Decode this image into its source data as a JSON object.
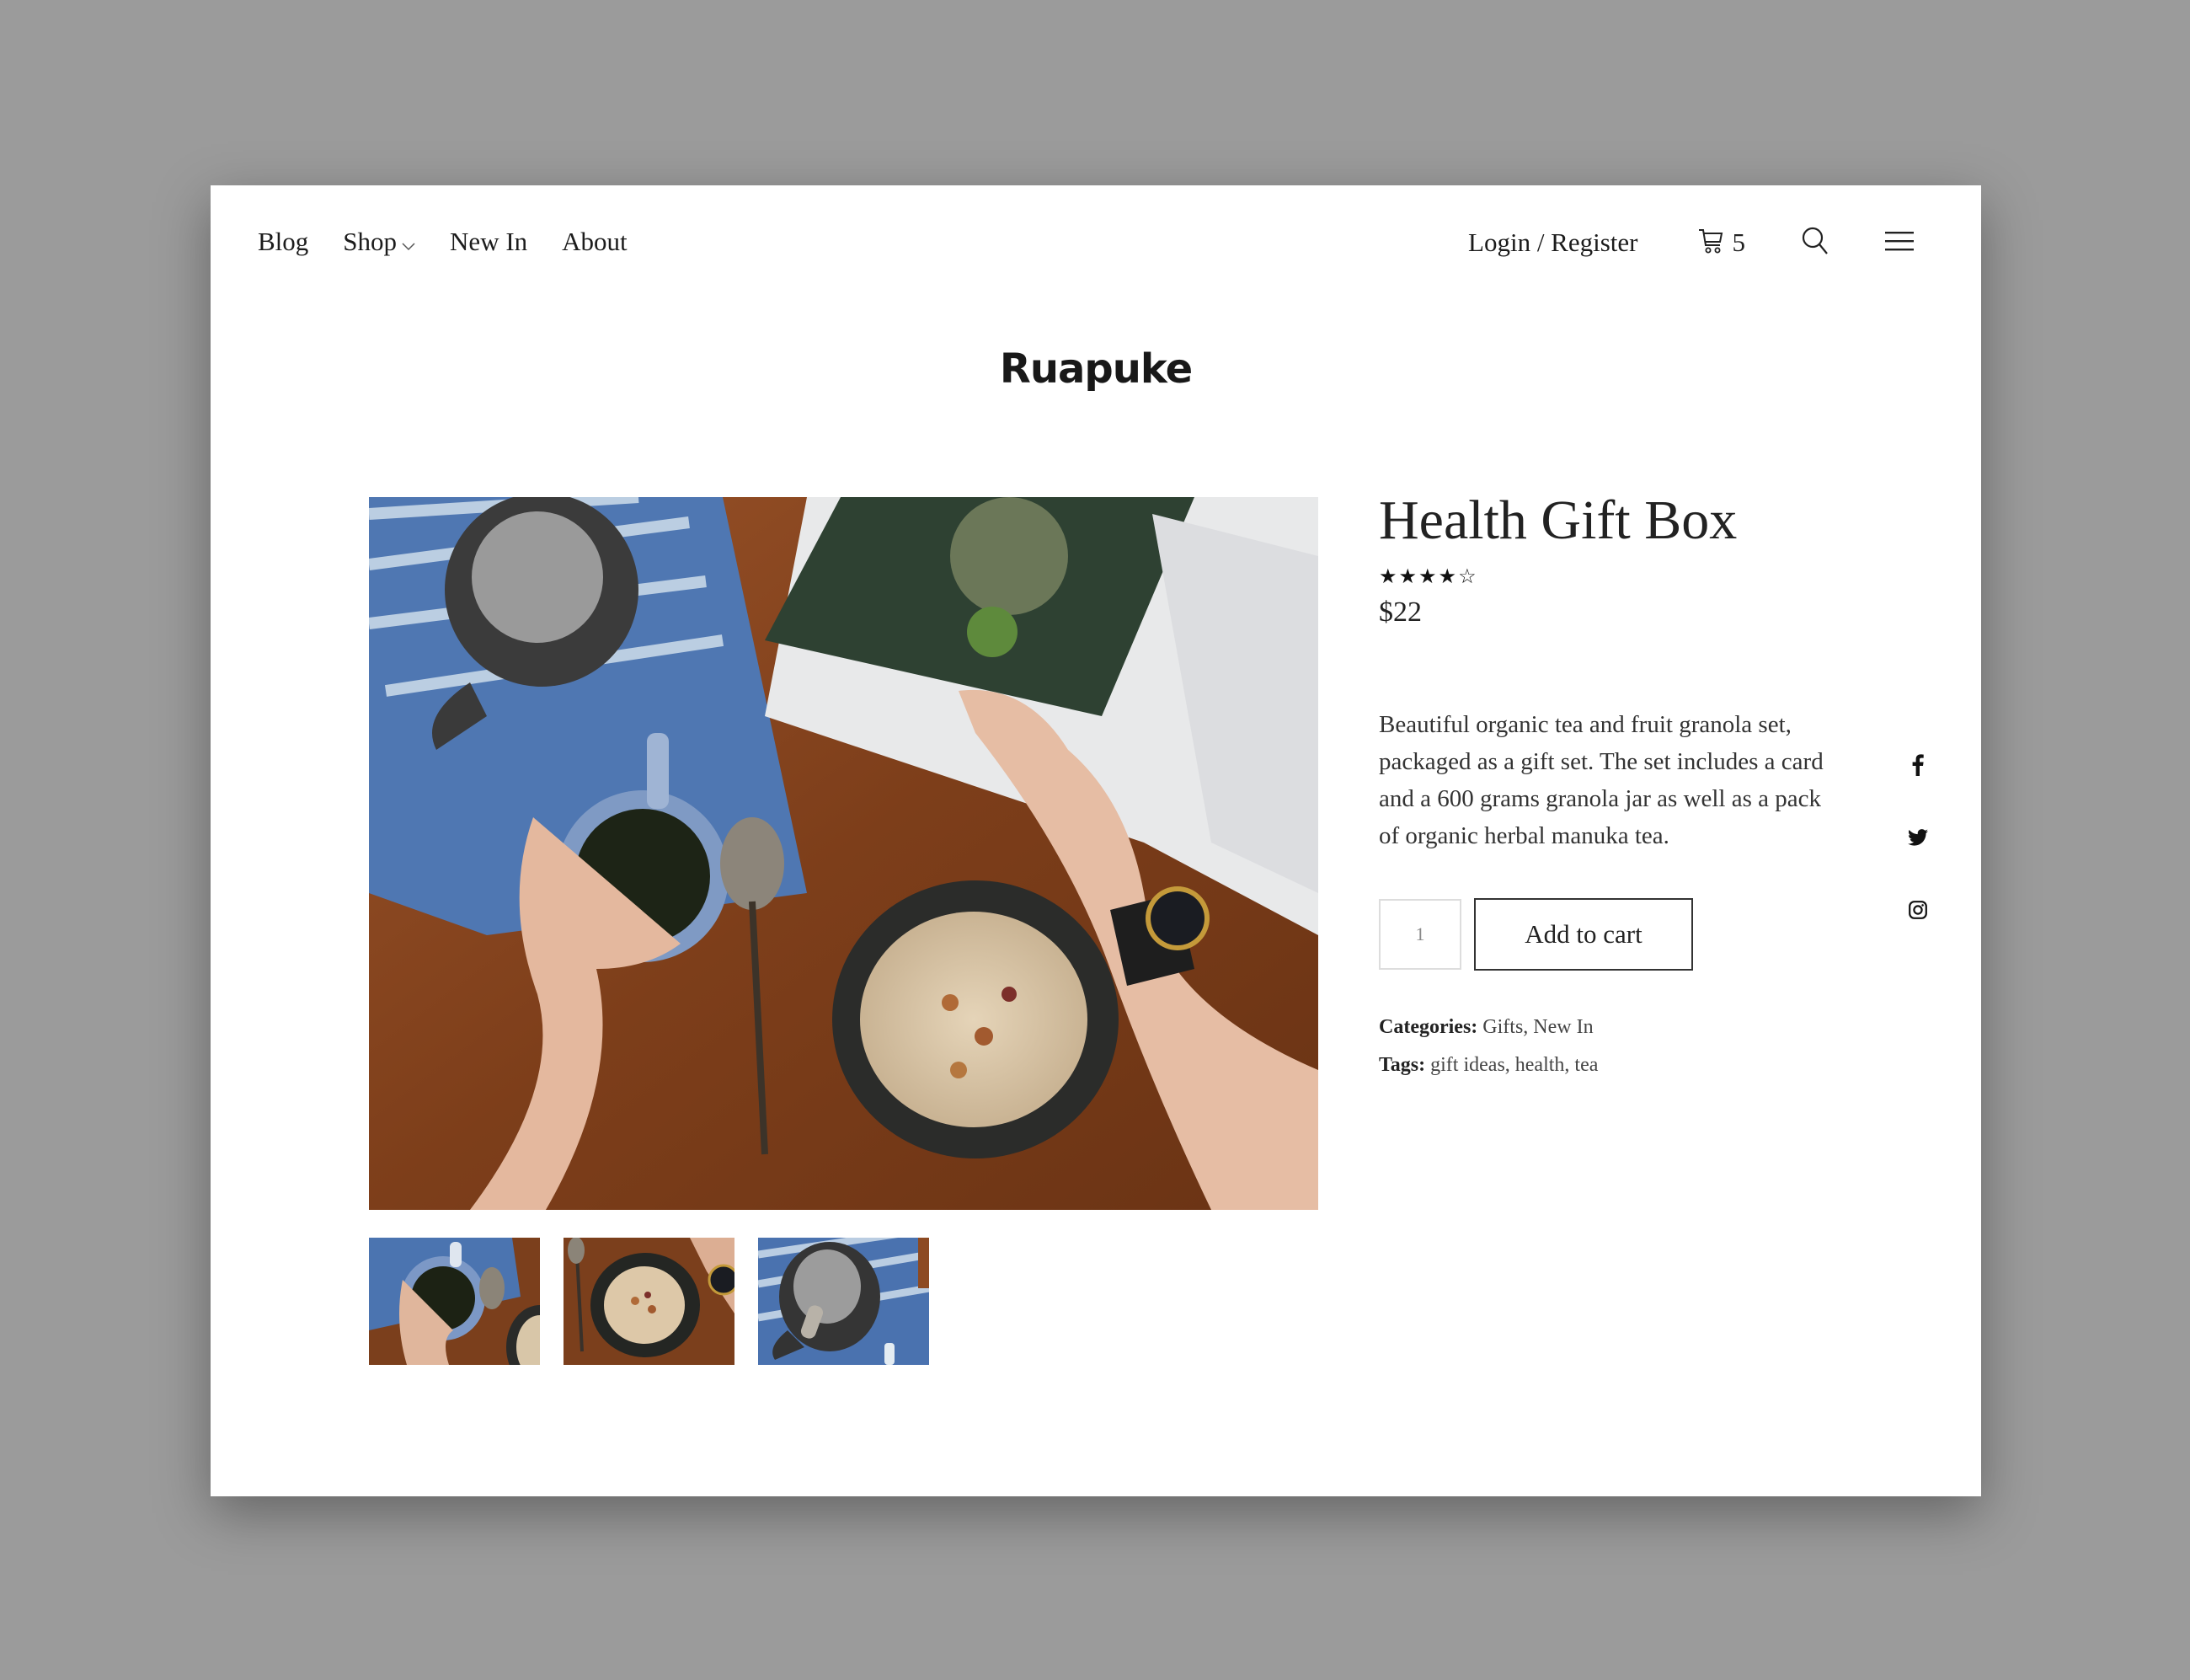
{
  "nav": {
    "left": [
      {
        "label": "Blog"
      },
      {
        "label": "Shop",
        "has_dropdown": true
      },
      {
        "label": "New In"
      },
      {
        "label": "About"
      }
    ],
    "login_label": "Login / Register",
    "cart_count": "5",
    "icons": {
      "cart": "cart-icon",
      "search": "search-icon",
      "menu": "hamburger-menu-icon",
      "dropdown": "chevron-down-icon"
    }
  },
  "brand": {
    "logo_text": "Ruapuke"
  },
  "product": {
    "title": "Health Gift Box",
    "rating": {
      "value": 4,
      "max": 5,
      "display": "★★★★☆"
    },
    "price": "$22",
    "description": "Beautiful organic tea and fruit granola set, packaged as a gift set. The set includes a card and a 600 grams granola jar as well as a pack of organic herbal manuka tea.",
    "quantity": "1",
    "add_to_cart_label": "Add to cart",
    "categories_label": "Categories:",
    "categories": [
      "Gifts",
      "New In"
    ],
    "tags_label": "Tags:",
    "tags": [
      "gift ideas",
      "health",
      "tea"
    ],
    "main_image_alt": "Top-down photo of tea mug, teapot on blue towel, granola bowl and open magazine on wooden table",
    "thumbnails": [
      {
        "alt": "Hand holding blue tea mug"
      },
      {
        "alt": "Granola bowl with spoon and wristwatch"
      },
      {
        "alt": "Dark teapot on blue striped towel"
      }
    ]
  },
  "social": [
    {
      "name": "facebook-icon"
    },
    {
      "name": "twitter-icon"
    },
    {
      "name": "instagram-icon"
    }
  ],
  "colors": {
    "page_bg": "#9b9b9b",
    "card_bg": "#ffffff",
    "text": "#222222",
    "border": "#333333"
  }
}
